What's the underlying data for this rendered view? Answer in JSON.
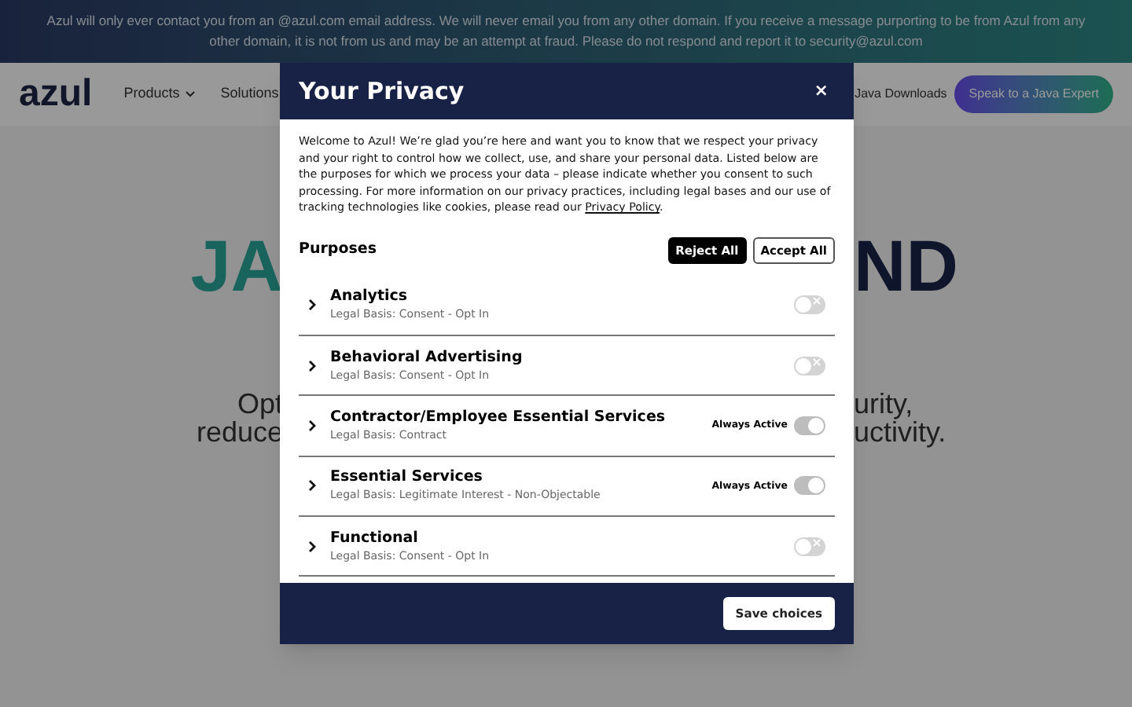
{
  "banner": {
    "text": "Azul will only ever contact you from an @azul.com email address. We will never email you from any other domain. If you receive a message purporting to be from Azul from any other domain, it is not from us and may be an attempt at fraud. Please do not respond and report it to security@azul.com"
  },
  "nav": {
    "logo": "azul",
    "items": [
      "Products",
      "Solutions"
    ],
    "right_link": "Java Downloads",
    "cta": "Speak to a Java Expert"
  },
  "hero": {
    "title_left": "JA",
    "title_right": "ND",
    "line1_left": "Opt",
    "line1_right": "urity,",
    "line2_left": "reduce",
    "line2_right": "uctivity."
  },
  "dialog": {
    "title": "Your Privacy",
    "close": "×",
    "intro": "Welcome to Azul! We’re glad you’re here and want you to know that we respect your privacy and your right to control how we collect, use, and share your personal data. Listed below are the purposes for which we process your data – please indicate whether you consent to such processing. For more information on our privacy practices, including legal bases and our use of tracking technologies like cookies, please read our",
    "policy_link": "Privacy Policy",
    "intro_end": ".",
    "purposes_heading": "Purposes",
    "reject": "Reject All",
    "accept": "Accept All",
    "purposes": [
      {
        "name": "Analytics",
        "basis": "Legal Basis: Consent - Opt In",
        "on": false,
        "disabled": false
      },
      {
        "name": "Behavioral Advertising",
        "basis": "Legal Basis: Consent - Opt In",
        "on": false,
        "disabled": false
      },
      {
        "name": "Contractor/Employee Essential Services",
        "basis": "Legal Basis: Contract",
        "on": true,
        "disabled": true,
        "badge": "Always Active"
      },
      {
        "name": "Essential Services",
        "basis": "Legal Basis: Legitimate Interest - Non-Objectable",
        "on": true,
        "disabled": true,
        "badge": "Always Active"
      },
      {
        "name": "Functional",
        "basis": "Legal Basis: Consent - Opt In",
        "on": false,
        "disabled": false
      }
    ],
    "save": "Save choices"
  }
}
